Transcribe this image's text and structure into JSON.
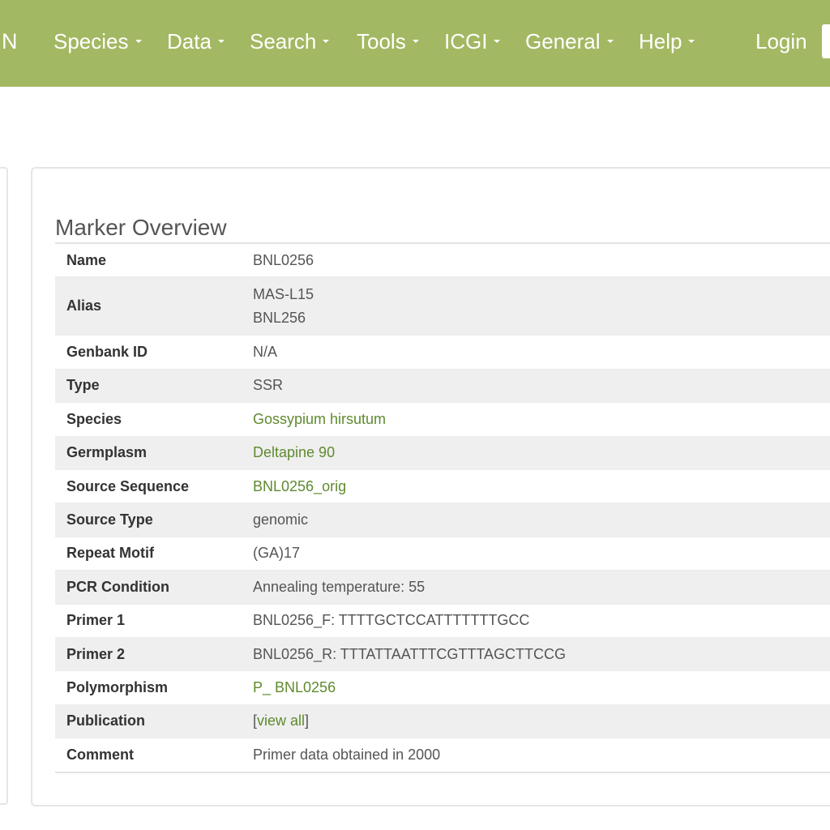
{
  "navbar": {
    "brand": "N",
    "items": [
      {
        "label": "Species"
      },
      {
        "label": "Data"
      },
      {
        "label": "Search"
      },
      {
        "label": "Tools"
      },
      {
        "label": "ICGI"
      },
      {
        "label": "General"
      },
      {
        "label": "Help"
      }
    ],
    "login": "Login"
  },
  "panel": {
    "title": "Marker Overview",
    "rows": [
      {
        "label": "Name",
        "value": "BNL0256"
      },
      {
        "label": "Alias",
        "value1": "MAS-L15",
        "value2": "BNL256"
      },
      {
        "label": "Genbank ID",
        "value": "N/A"
      },
      {
        "label": "Type",
        "value": "SSR"
      },
      {
        "label": "Species",
        "value": "Gossypium hirsutum"
      },
      {
        "label": "Germplasm",
        "value": "Deltapine 90"
      },
      {
        "label": "Source Sequence",
        "value": "BNL0256_orig"
      },
      {
        "label": "Source Type",
        "value": "genomic"
      },
      {
        "label": "Repeat Motif",
        "value": "(GA)17"
      },
      {
        "label": "PCR Condition",
        "value": "Annealing temperature: 55"
      },
      {
        "label": "Primer 1",
        "value": "BNL0256_F: TTTTGCTCCATTTTTTTGCC"
      },
      {
        "label": "Primer 2",
        "value": "BNL0256_R: TTTATTAATTTCGTTTAGCTTCCG"
      },
      {
        "label": "Polymorphism",
        "value": "P_ BNL0256"
      },
      {
        "label": "Publication",
        "open": "[",
        "link": "view all",
        "close": "]"
      },
      {
        "label": "Comment",
        "value": "Primer data obtained in 2000"
      }
    ]
  },
  "colors": {
    "navbar": "#a3b862",
    "link": "#5f8a2e",
    "row_alt": "#efefef"
  }
}
